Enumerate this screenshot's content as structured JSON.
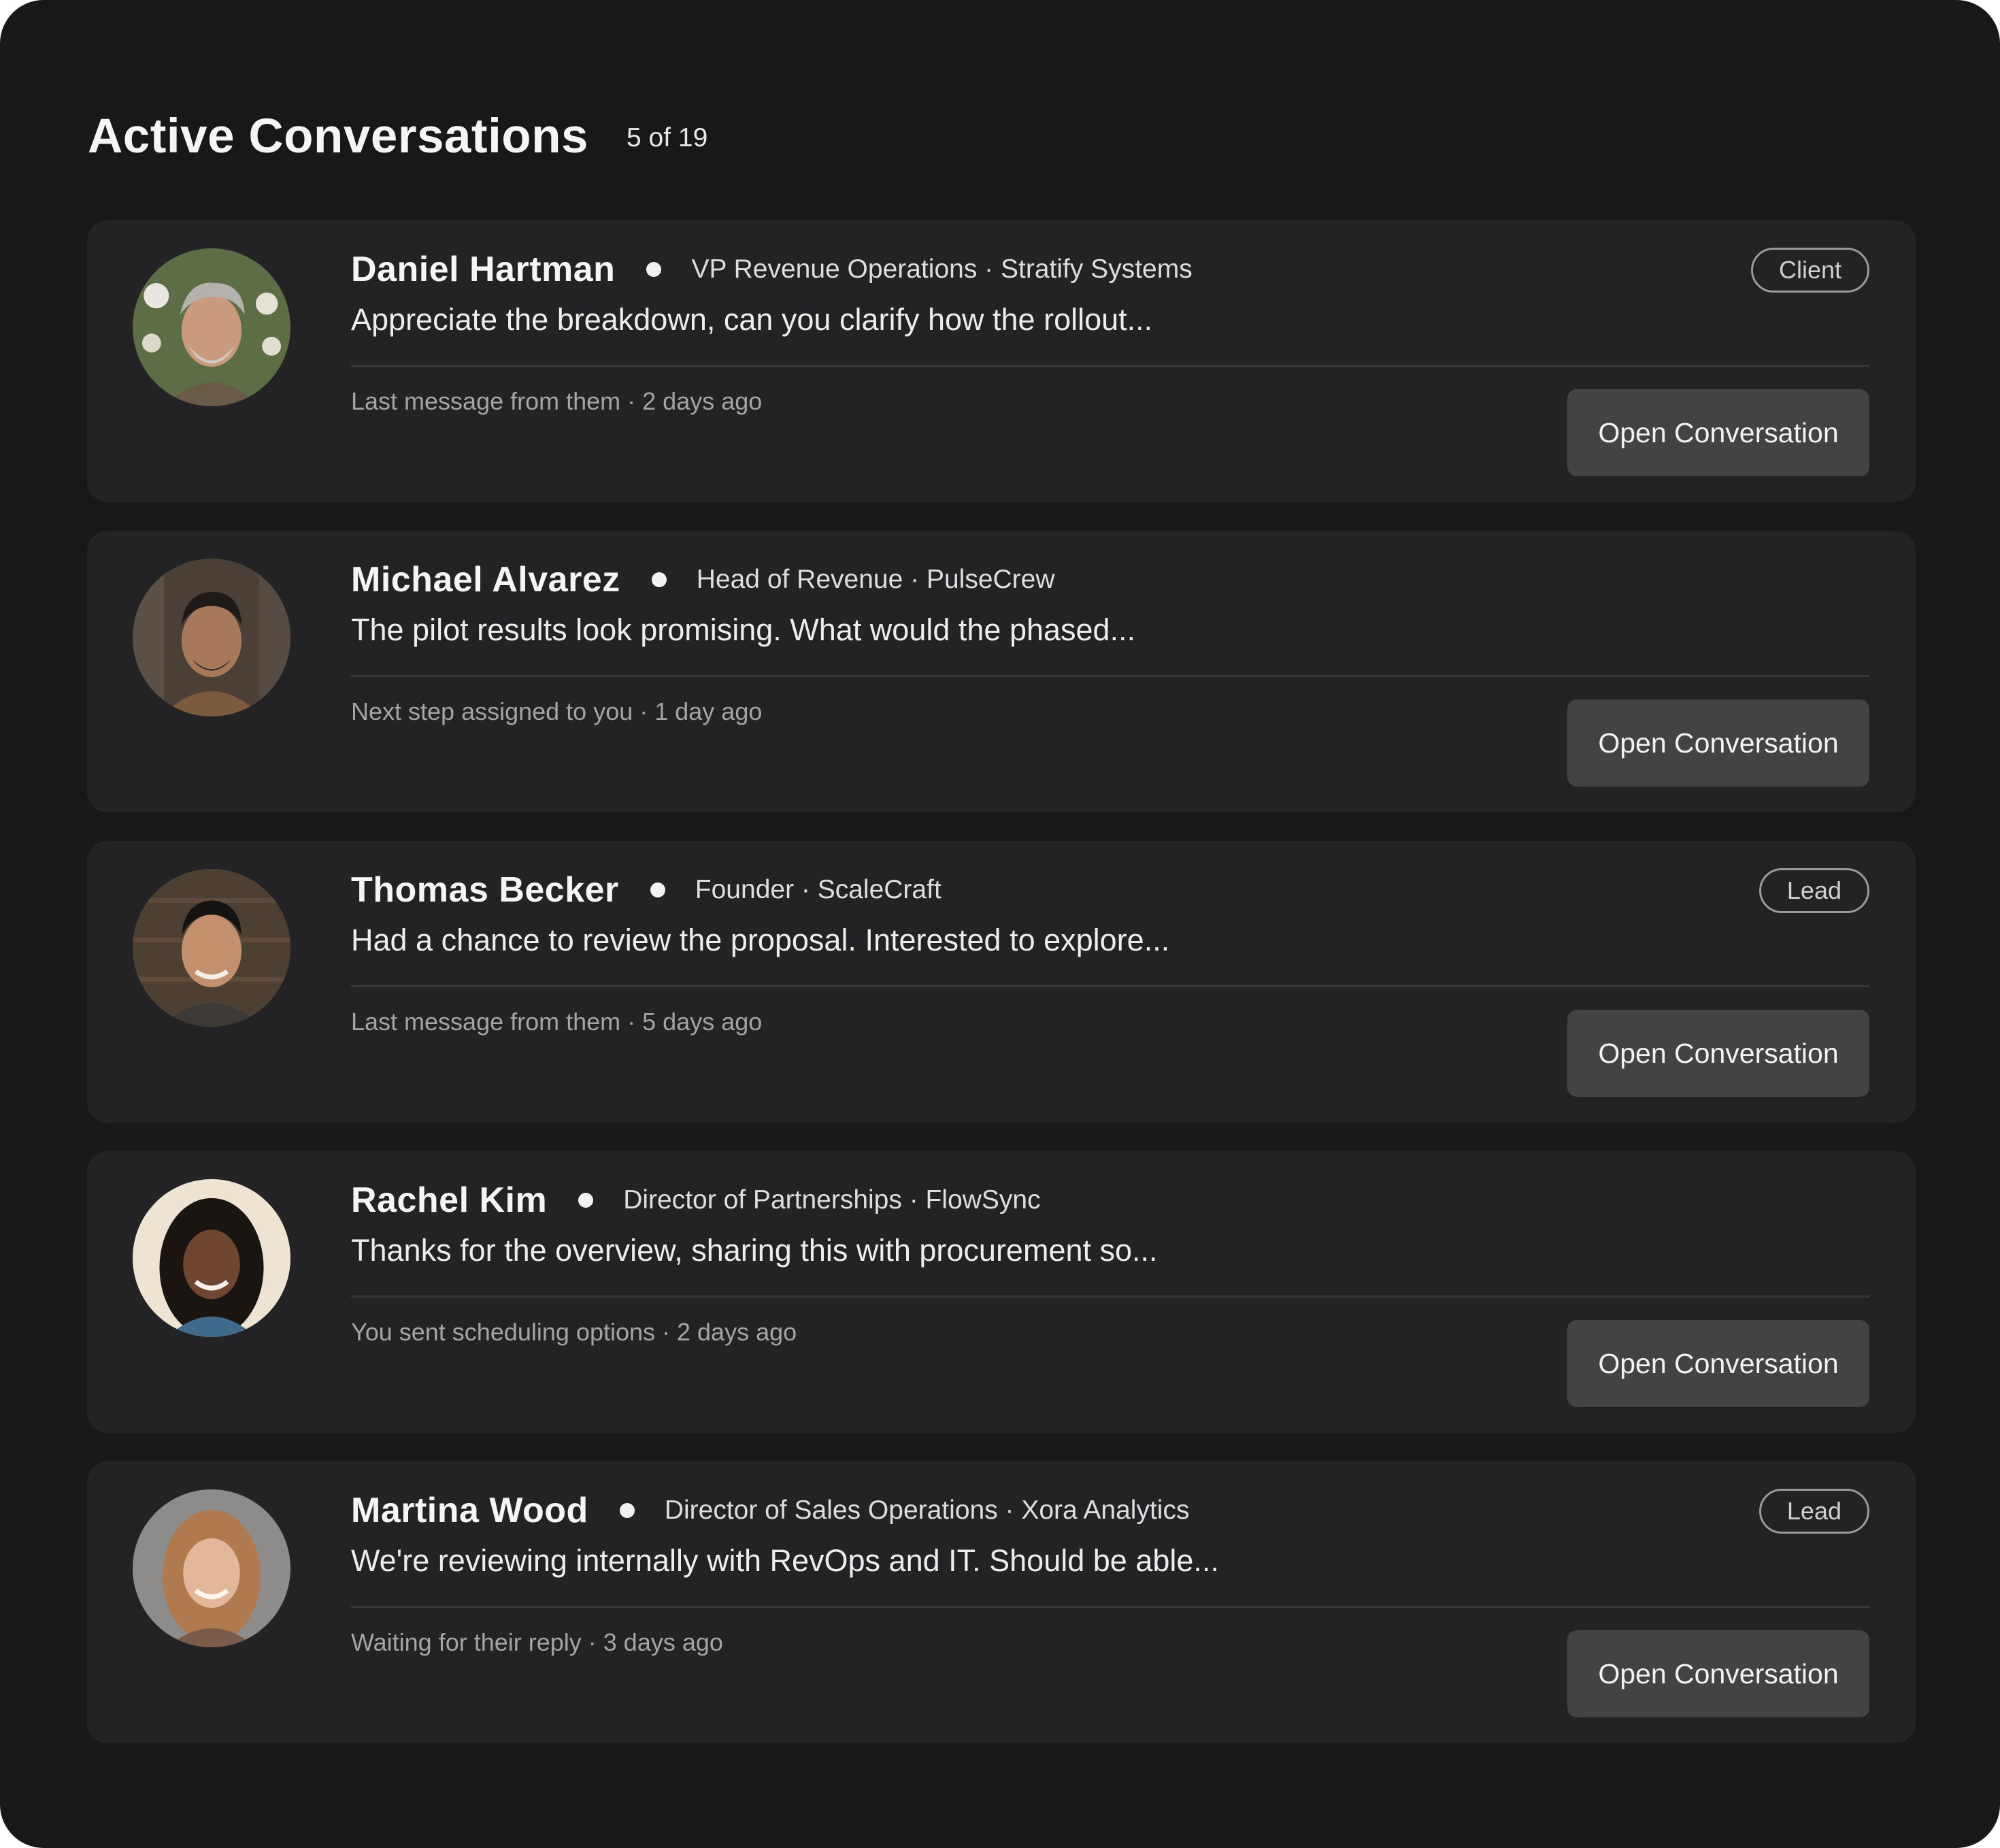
{
  "header": {
    "title": "Active Conversations",
    "count": "5 of 19"
  },
  "conversations": [
    {
      "name": "Daniel Hartman",
      "role": "VP Revenue Operations · Stratify Systems",
      "message": "Appreciate the breakdown, can you clarify how the rollout...",
      "meta": "Last message from them · 2 days ago",
      "badge": "Client",
      "button": "Open Conversation"
    },
    {
      "name": "Michael Alvarez",
      "role": "Head of Revenue · PulseCrew",
      "message": "The pilot results look promising. What would the phased...",
      "meta": "Next step assigned to you · 1 day ago",
      "button": "Open Conversation"
    },
    {
      "name": "Thomas Becker",
      "role": "Founder · ScaleCraft",
      "message": "Had a chance to review the proposal. Interested to explore...",
      "meta": "Last message from them · 5 days ago",
      "badge": "Lead",
      "button": "Open Conversation"
    },
    {
      "name": "Rachel Kim",
      "role": "Director of Partnerships · FlowSync",
      "message": "Thanks for the overview, sharing this with procurement so...",
      "meta": "You sent scheduling options · 2 days ago",
      "button": "Open Conversation"
    },
    {
      "name": "Martina Wood",
      "role": "Director of Sales Operations · Xora Analytics",
      "message": "We're reviewing internally with RevOps and IT. Should be able...",
      "meta": "Waiting for their reply · 3 days ago",
      "badge": "Lead",
      "button": "Open Conversation"
    }
  ]
}
